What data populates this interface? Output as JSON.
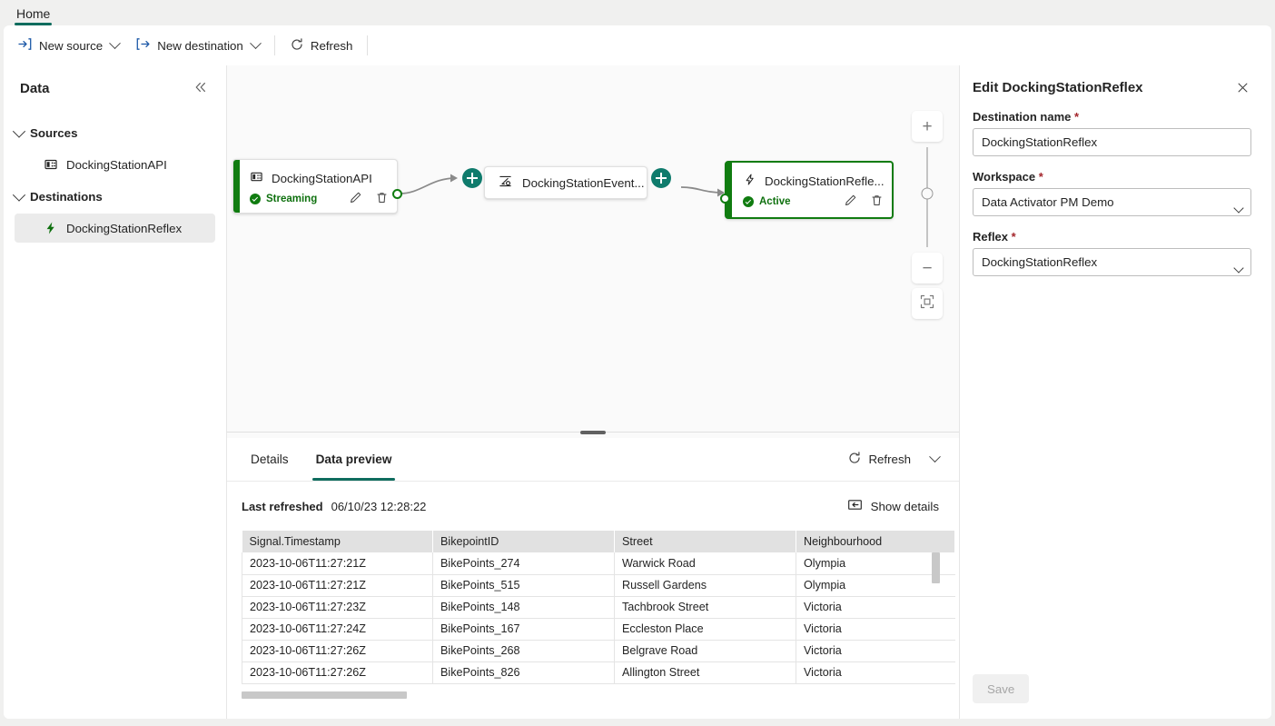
{
  "ribbon": {
    "tabs": [
      {
        "label": "Home",
        "active": true
      }
    ],
    "buttons": [
      {
        "label": "New source",
        "icon": "new-source-icon",
        "chevron": true
      },
      {
        "label": "New destination",
        "icon": "new-destination-icon",
        "chevron": true
      },
      {
        "label": "Refresh",
        "icon": "refresh-icon",
        "chevron": false
      }
    ]
  },
  "sidebar": {
    "title": "Data",
    "collapse_icon": "collapse-chevrons-icon",
    "groups": [
      {
        "label": "Sources",
        "items": [
          {
            "label": "DockingStationAPI",
            "icon": "eventstream-source-icon",
            "selected": false
          }
        ]
      },
      {
        "label": "Destinations",
        "items": [
          {
            "label": "DockingStationReflex",
            "icon": "reflex-bolt-icon",
            "selected": true
          }
        ]
      }
    ]
  },
  "canvas": {
    "nodes": [
      {
        "name": "DockingStationAPI",
        "icon": "eventstream-source-icon",
        "status": "Streaming",
        "status_color": "#0e700e",
        "accent_color": "#107c10",
        "selected": false,
        "actions": [
          "edit-icon",
          "delete-icon"
        ]
      },
      {
        "name": "DockingStationEvent...",
        "icon": "eventstream-icon"
      },
      {
        "name": "DockingStationRefle...",
        "icon": "reflex-bolt-icon",
        "status": "Active",
        "status_color": "#0e700e",
        "accent_color": "#107c10",
        "selected": true,
        "actions": [
          "edit-icon",
          "delete-icon"
        ]
      }
    ],
    "add_buttons": [
      "add-node-button",
      "add-node-button"
    ],
    "zoom_controls": {
      "zoom_in": "+",
      "zoom_out": "−",
      "fit_to_screen": "fit-to-screen-icon"
    }
  },
  "bottom_panel": {
    "tabs": [
      {
        "label": "Details",
        "active": false
      },
      {
        "label": "Data preview",
        "active": true
      }
    ],
    "refresh_label": "Refresh",
    "refresh_icon": "refresh-icon",
    "chevron_icon": "chevron-down-icon",
    "last_refreshed_label": "Last refreshed",
    "last_refreshed_value": "06/10/23 12:28:22",
    "show_details_label": "Show details",
    "show_details_icon": "show-details-icon",
    "table": {
      "columns": [
        "Signal.Timestamp",
        "BikepointID",
        "Street",
        "Neighbourhood"
      ],
      "rows": [
        [
          "2023-10-06T11:27:21Z",
          "BikePoints_274",
          "Warwick Road",
          "Olympia"
        ],
        [
          "2023-10-06T11:27:21Z",
          "BikePoints_515",
          "Russell Gardens",
          "Olympia"
        ],
        [
          "2023-10-06T11:27:23Z",
          "BikePoints_148",
          "Tachbrook Street",
          "Victoria"
        ],
        [
          "2023-10-06T11:27:24Z",
          "BikePoints_167",
          "Eccleston Place",
          "Victoria"
        ],
        [
          "2023-10-06T11:27:26Z",
          "BikePoints_268",
          "Belgrave Road",
          "Victoria"
        ],
        [
          "2023-10-06T11:27:26Z",
          "BikePoints_826",
          "Allington Street",
          "Victoria"
        ]
      ]
    }
  },
  "right_pane": {
    "title": "Edit DockingStationReflex",
    "close_icon": "close-icon",
    "fields": {
      "destination_name": {
        "label": "Destination name",
        "required": "*",
        "value": "DockingStationReflex",
        "placeholder": ""
      },
      "workspace": {
        "label": "Workspace",
        "required": "*",
        "value": "Data Activator PM Demo"
      },
      "reflex": {
        "label": "Reflex",
        "required": "*",
        "value": "DockingStationReflex"
      }
    },
    "save_label": "Save"
  },
  "colors": {
    "accent_teal": "#0f6c5e",
    "status_green": "#107c10",
    "plus_green": "#0f7b6c",
    "required_red": "#a4262c",
    "page_bg": "#f0f0ef"
  }
}
